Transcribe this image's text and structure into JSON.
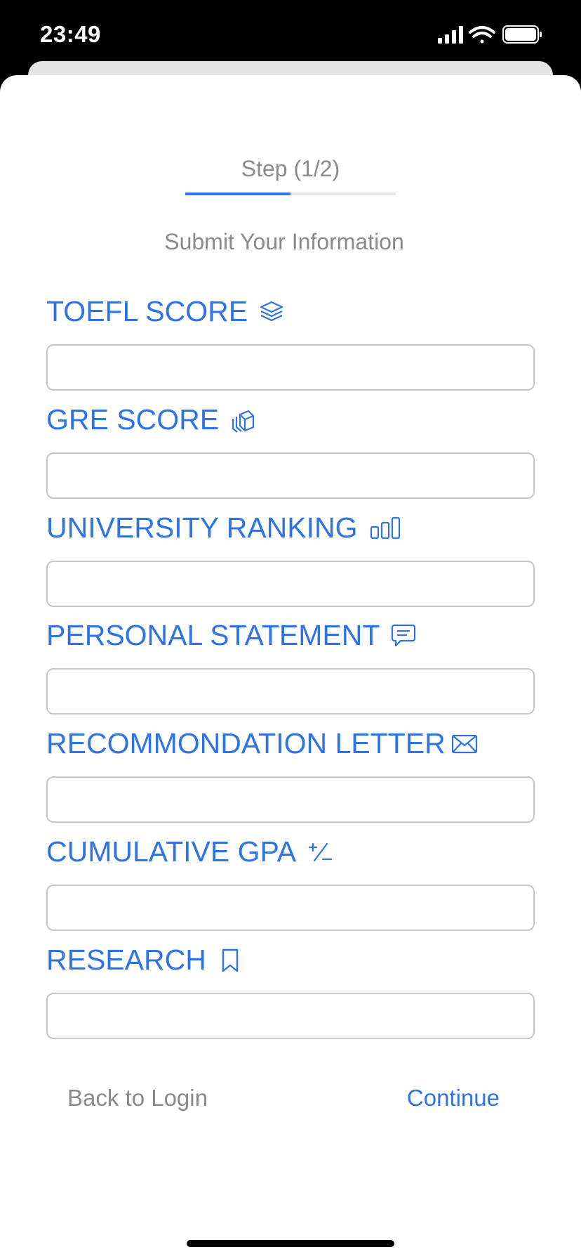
{
  "status_bar": {
    "time": "23:49",
    "icons": [
      "signal-icon",
      "wifi-icon",
      "battery-icon"
    ]
  },
  "header": {
    "step_label": "Step (1/2)",
    "progress_fraction": 0.5,
    "subtitle": "Submit Your Information"
  },
  "colors": {
    "accent": "#2f74e6",
    "muted_text": "#8a8a8e",
    "input_border": "#c7c7cc"
  },
  "fields": [
    {
      "label": "TOEFL SCORE",
      "icon": "layers-icon",
      "value": "",
      "placeholder": ""
    },
    {
      "label": "GRE SCORE",
      "icon": "cube-icon",
      "value": "",
      "placeholder": ""
    },
    {
      "label": "UNIVERSITY RANKING",
      "icon": "chart-bar-icon",
      "value": "",
      "placeholder": ""
    },
    {
      "label": "PERSONAL STATEMENT",
      "icon": "message-icon",
      "value": "",
      "placeholder": ""
    },
    {
      "label": "RECOMMONDATION LETTER",
      "icon": "envelope-icon",
      "value": "",
      "placeholder": ""
    },
    {
      "label": "CUMULATIVE GPA",
      "icon": "plus-minus-icon",
      "value": "",
      "placeholder": ""
    },
    {
      "label": "RESEARCH",
      "icon": "bookmark-icon",
      "value": "",
      "placeholder": ""
    }
  ],
  "footer": {
    "back_label": "Back to Login",
    "continue_label": "Continue"
  }
}
